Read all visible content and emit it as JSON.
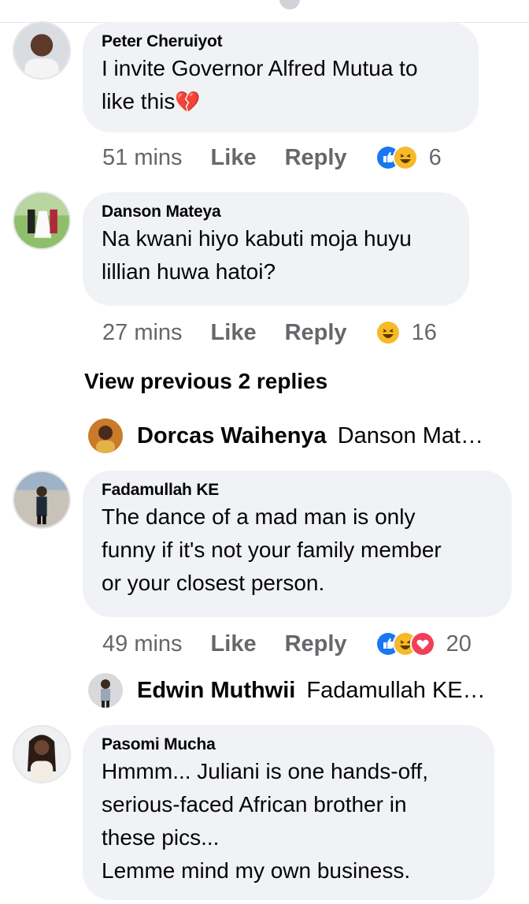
{
  "comments": [
    {
      "author": "Peter Cheruiyot",
      "lines": [
        "I invite Governor Alfred Mutua to",
        "like this"
      ],
      "emoji": "💔",
      "time": "51 mins",
      "like": "Like",
      "reply": "Reply",
      "reactions": [
        "like-icon",
        "haha-icon"
      ],
      "count": "6"
    },
    {
      "author": "Danson Mateya",
      "lines": [
        "Na kwani hiyo kabuti moja huyu",
        "lillian huwa hatoi?"
      ],
      "time": "27 mins",
      "like": "Like",
      "reply": "Reply",
      "reactions": [
        "haha-icon"
      ],
      "count": "16",
      "view_previous": "View previous 2 replies",
      "reply_preview": {
        "author": "Dorcas Waihenya",
        "text": "Danson Mat…"
      }
    },
    {
      "author": "Fadamullah KE",
      "lines": [
        "The dance of a mad man is only",
        "funny if it's not your family member",
        "or your closest person."
      ],
      "time": "49 mins",
      "like": "Like",
      "reply": "Reply",
      "reactions": [
        "like-icon",
        "haha-icon",
        "love-icon"
      ],
      "count": "20",
      "reply_preview": {
        "author": "Edwin Muthwii",
        "text": "Fadamullah KE…"
      }
    },
    {
      "author": "Pasomi Mucha",
      "lines": [
        "Hmmm... Juliani is one hands-off,",
        "serious-faced African brother in",
        "these pics...",
        "Lemme mind my own business."
      ]
    }
  ],
  "colors": {
    "bubble": "#f0f2f5",
    "meta": "#65676b",
    "like_blue": "#1877f2",
    "haha_yellow": "#f7b928",
    "love_red": "#f33e58"
  }
}
